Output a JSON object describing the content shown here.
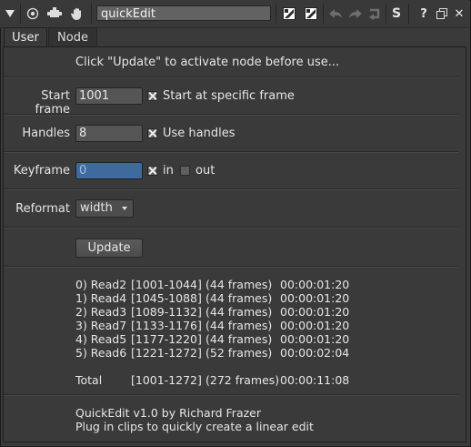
{
  "toolbar": {
    "title": "quickEdit",
    "icons": [
      "collapse-arrow-icon",
      "circle-target-icon",
      "node-icon",
      "hand-icon",
      "color-swatch-1-icon",
      "color-swatch-2-icon",
      "undo-icon",
      "redo-icon",
      "revert-icon",
      "s-icon",
      "help-icon",
      "float-window-icon",
      "close-icon"
    ],
    "help_label": "?",
    "s_label": "S",
    "close_label": "✕"
  },
  "tabs": [
    {
      "label": "User",
      "active": true
    },
    {
      "label": "Node",
      "active": false
    }
  ],
  "info": "Click \"Update\" to activate node before use...",
  "start_frame": {
    "label": "Start frame",
    "value": "1001",
    "checkbox_label": "Start at specific frame",
    "checked": true
  },
  "handles": {
    "label": "Handles",
    "value": "8",
    "checkbox_label": "Use handles",
    "checked": true
  },
  "keyframe": {
    "label": "Keyframe",
    "value": "0",
    "in_label": "in",
    "in_checked": true,
    "out_label": "out",
    "out_checked": false
  },
  "reformat": {
    "label": "Reformat",
    "value": "width"
  },
  "update_label": "Update",
  "clips": [
    {
      "id": "0) Read2",
      "range": "[1001-1044]",
      "frames": "(44 frames)",
      "tc": "00:00:01:20"
    },
    {
      "id": "1) Read4",
      "range": "[1045-1088]",
      "frames": "(44 frames)",
      "tc": "00:00:01:20"
    },
    {
      "id": "2) Read3",
      "range": "[1089-1132]",
      "frames": "(44 frames)",
      "tc": "00:00:01:20"
    },
    {
      "id": "3) Read7",
      "range": "[1133-1176]",
      "frames": "(44 frames)",
      "tc": "00:00:01:20"
    },
    {
      "id": "4) Read5",
      "range": "[1177-1220]",
      "frames": "(44 frames)",
      "tc": "00:00:01:20"
    },
    {
      "id": "5) Read6",
      "range": "[1221-1272]",
      "frames": "(52 frames)",
      "tc": "00:00:02:04"
    }
  ],
  "total": {
    "id": "Total",
    "range": "[1001-1272]",
    "frames": "(272 frames)",
    "tc": "00:00:11:08"
  },
  "footer": {
    "line1": "QuickEdit v1.0 by Richard Frazer",
    "line2": "Plug in clips to quickly create a linear edit"
  },
  "colors": {
    "background": "#3a3a3a",
    "input_focus": "#3f6a9e"
  }
}
